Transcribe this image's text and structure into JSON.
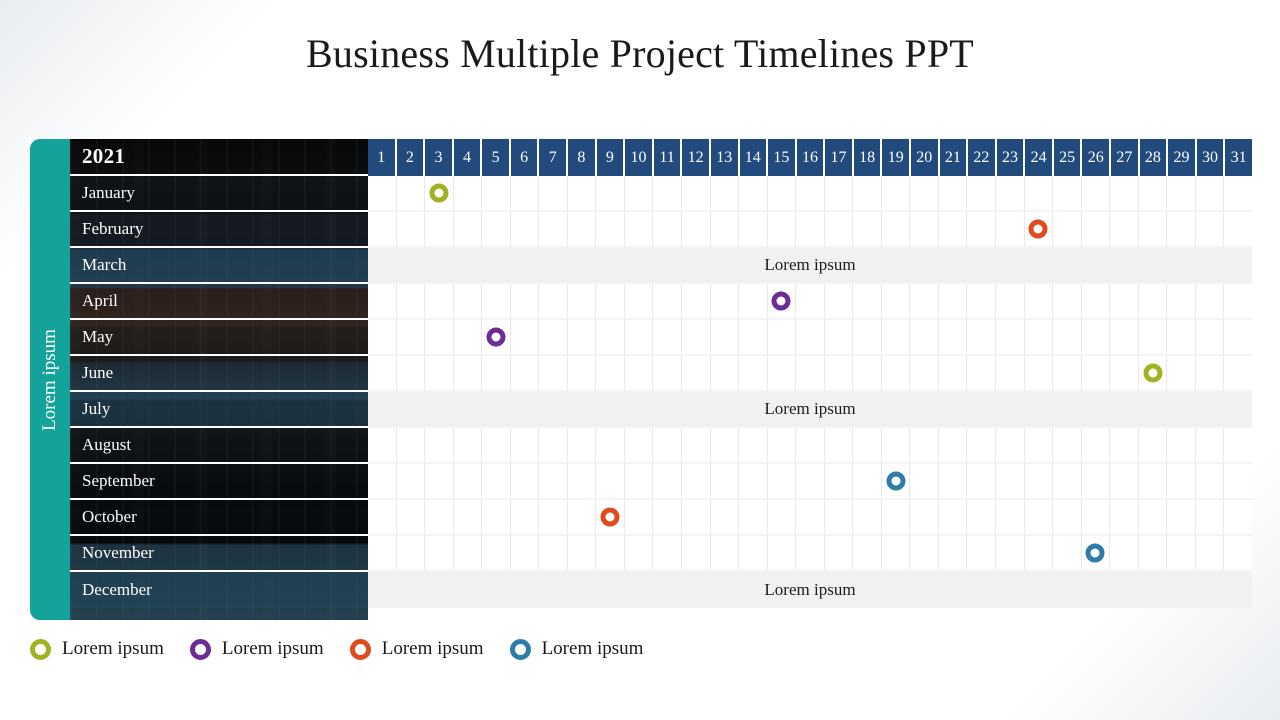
{
  "slide": {
    "title": "Business Multiple Project Timelines PPT"
  },
  "rail": {
    "label": "Lorem ipsum"
  },
  "colors": {
    "rail_teal": "#14A39A",
    "day_header_navy": "#234A7D",
    "band_gray": "#f1f1f1",
    "series_olive": "#A2B224",
    "series_purple": "#6E2C96",
    "series_orange": "#E04A1F",
    "series_blue": "#2E7CA8"
  },
  "legend": {
    "items": [
      {
        "label": "Lorem ipsum",
        "color": "#A2B224",
        "name": "series-olive"
      },
      {
        "label": "Lorem ipsum",
        "color": "#6E2C96",
        "name": "series-purple"
      },
      {
        "label": "Lorem ipsum",
        "color": "#E04A1F",
        "name": "series-orange"
      },
      {
        "label": "Lorem ipsum",
        "color": "#2E7CA8",
        "name": "series-blue"
      }
    ]
  },
  "chart_data": {
    "type": "table",
    "title": "Business Multiple Project Timelines PPT",
    "xlabel": "",
    "ylabel": "Lorem ipsum",
    "grid": true,
    "legend_position": "bottom-left",
    "corner_header": "2021",
    "columns": [
      "1",
      "2",
      "3",
      "4",
      "5",
      "6",
      "7",
      "8",
      "9",
      "10",
      "11",
      "12",
      "13",
      "14",
      "15",
      "16",
      "17",
      "18",
      "19",
      "20",
      "21",
      "22",
      "23",
      "24",
      "25",
      "26",
      "27",
      "28",
      "29",
      "30",
      "31"
    ],
    "rows": [
      {
        "label": "January",
        "band": false,
        "band_label": "",
        "markers": [
          {
            "day": 3,
            "color": "#A2B224"
          }
        ]
      },
      {
        "label": "February",
        "band": false,
        "band_label": "",
        "markers": [
          {
            "day": 24,
            "color": "#E04A1F"
          }
        ]
      },
      {
        "label": "March",
        "band": true,
        "band_label": "Lorem ipsum",
        "markers": []
      },
      {
        "label": "April",
        "band": false,
        "band_label": "",
        "markers": [
          {
            "day": 15,
            "color": "#6E2C96"
          }
        ]
      },
      {
        "label": "May",
        "band": false,
        "band_label": "",
        "markers": [
          {
            "day": 5,
            "color": "#6E2C96"
          }
        ]
      },
      {
        "label": "June",
        "band": false,
        "band_label": "",
        "markers": [
          {
            "day": 28,
            "color": "#A2B224"
          }
        ]
      },
      {
        "label": "July",
        "band": true,
        "band_label": "Lorem ipsum",
        "markers": []
      },
      {
        "label": "August",
        "band": false,
        "band_label": "",
        "markers": []
      },
      {
        "label": "September",
        "band": false,
        "band_label": "",
        "markers": [
          {
            "day": 19,
            "color": "#2E7CA8"
          }
        ]
      },
      {
        "label": "October",
        "band": false,
        "band_label": "",
        "markers": [
          {
            "day": 9,
            "color": "#E04A1F"
          }
        ]
      },
      {
        "label": "November",
        "band": false,
        "band_label": "",
        "markers": [
          {
            "day": 26,
            "color": "#2E7CA8"
          }
        ]
      },
      {
        "label": "December",
        "band": true,
        "band_label": "Lorem ipsum",
        "markers": []
      }
    ]
  }
}
